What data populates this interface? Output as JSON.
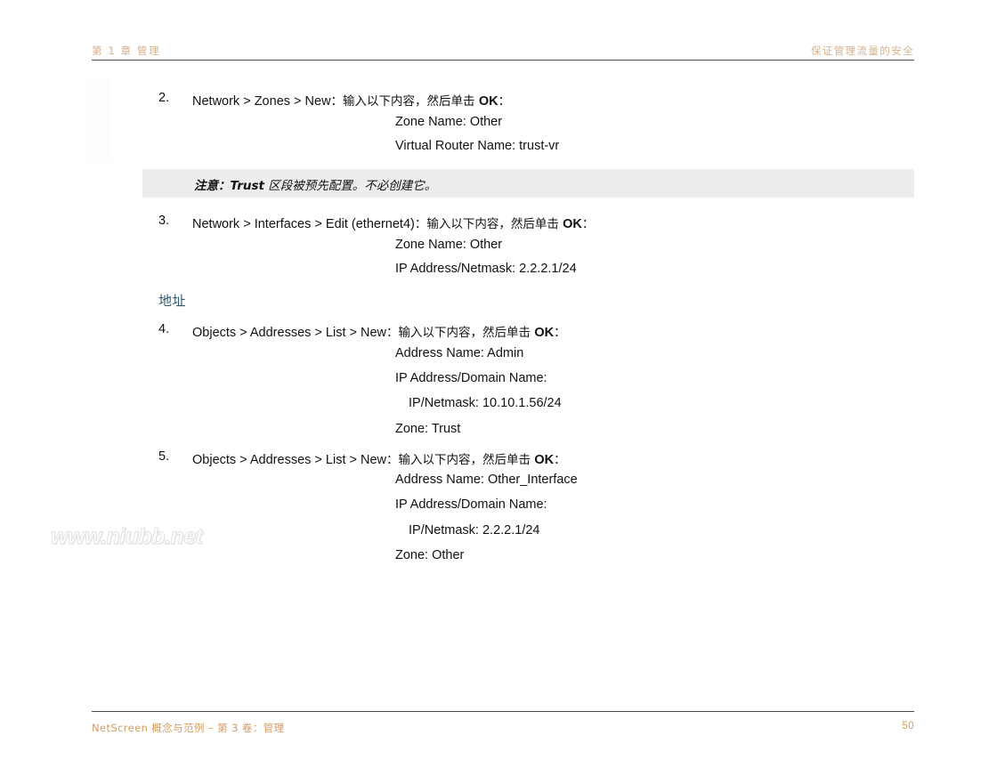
{
  "header": {
    "left": "第 1 章 管理",
    "right": "保证管理流量的安全",
    "text_color": "#d7b08c",
    "rule_color": "#4c4c4c"
  },
  "steps": [
    {
      "number": "2.",
      "path": "Network > Zones > New",
      "instruction_prefix": "：输入以下内容，然后单击 ",
      "ok_label": "OK",
      "instruction_suffix": "：",
      "sublines": [
        {
          "text": "Zone Name: Other",
          "indent": 1
        },
        {
          "text": "Virtual Router Name: trust-vr",
          "indent": 1
        }
      ]
    },
    {
      "number": "3.",
      "path": "Network > Interfaces > Edit (ethernet4)",
      "instruction_prefix": "：输入以下内容，然后单击 ",
      "ok_label": "OK",
      "instruction_suffix": "：",
      "sublines": [
        {
          "text": "Zone Name: Other",
          "indent": 1
        },
        {
          "text": "IP Address/Netmask: 2.2.2.1/24",
          "indent": 1
        }
      ]
    },
    {
      "number": "4.",
      "path": "Objects > Addresses > List > New",
      "instruction_prefix": "：输入以下内容，然后单击 ",
      "ok_label": "OK",
      "instruction_suffix": "：",
      "sublines": [
        {
          "text": "Address Name: Admin",
          "indent": 1
        },
        {
          "text": "IP Address/Domain Name:",
          "indent": 1
        },
        {
          "text": "IP/Netmask: 10.10.1.56/24",
          "indent": 2
        },
        {
          "text": "Zone: Trust",
          "indent": 1
        }
      ]
    },
    {
      "number": "5.",
      "path": "Objects > Addresses > List > New",
      "instruction_prefix": "：输入以下内容，然后单击 ",
      "ok_label": "OK",
      "instruction_suffix": "：",
      "sublines": [
        {
          "text": "Address Name: Other_Interface",
          "indent": 1
        },
        {
          "text": "IP Address/Domain Name:",
          "indent": 1
        },
        {
          "text": "IP/Netmask: 2.2.2.1/24",
          "indent": 2
        },
        {
          "text": "Zone: Other",
          "indent": 1
        }
      ]
    }
  ],
  "note": {
    "label": "注意：",
    "highlight": "Trust",
    "body": " 区段被预先配置。不必创建它。",
    "background": "#ededed"
  },
  "section_heading": {
    "text": "地址",
    "color": "#2e5871"
  },
  "watermark": {
    "text": "www.niubb.net"
  },
  "footer": {
    "left": "NetScreen 概念与范例 – 第 3 卷：管理",
    "page_number": "50",
    "text_color": "#d59a5e"
  }
}
